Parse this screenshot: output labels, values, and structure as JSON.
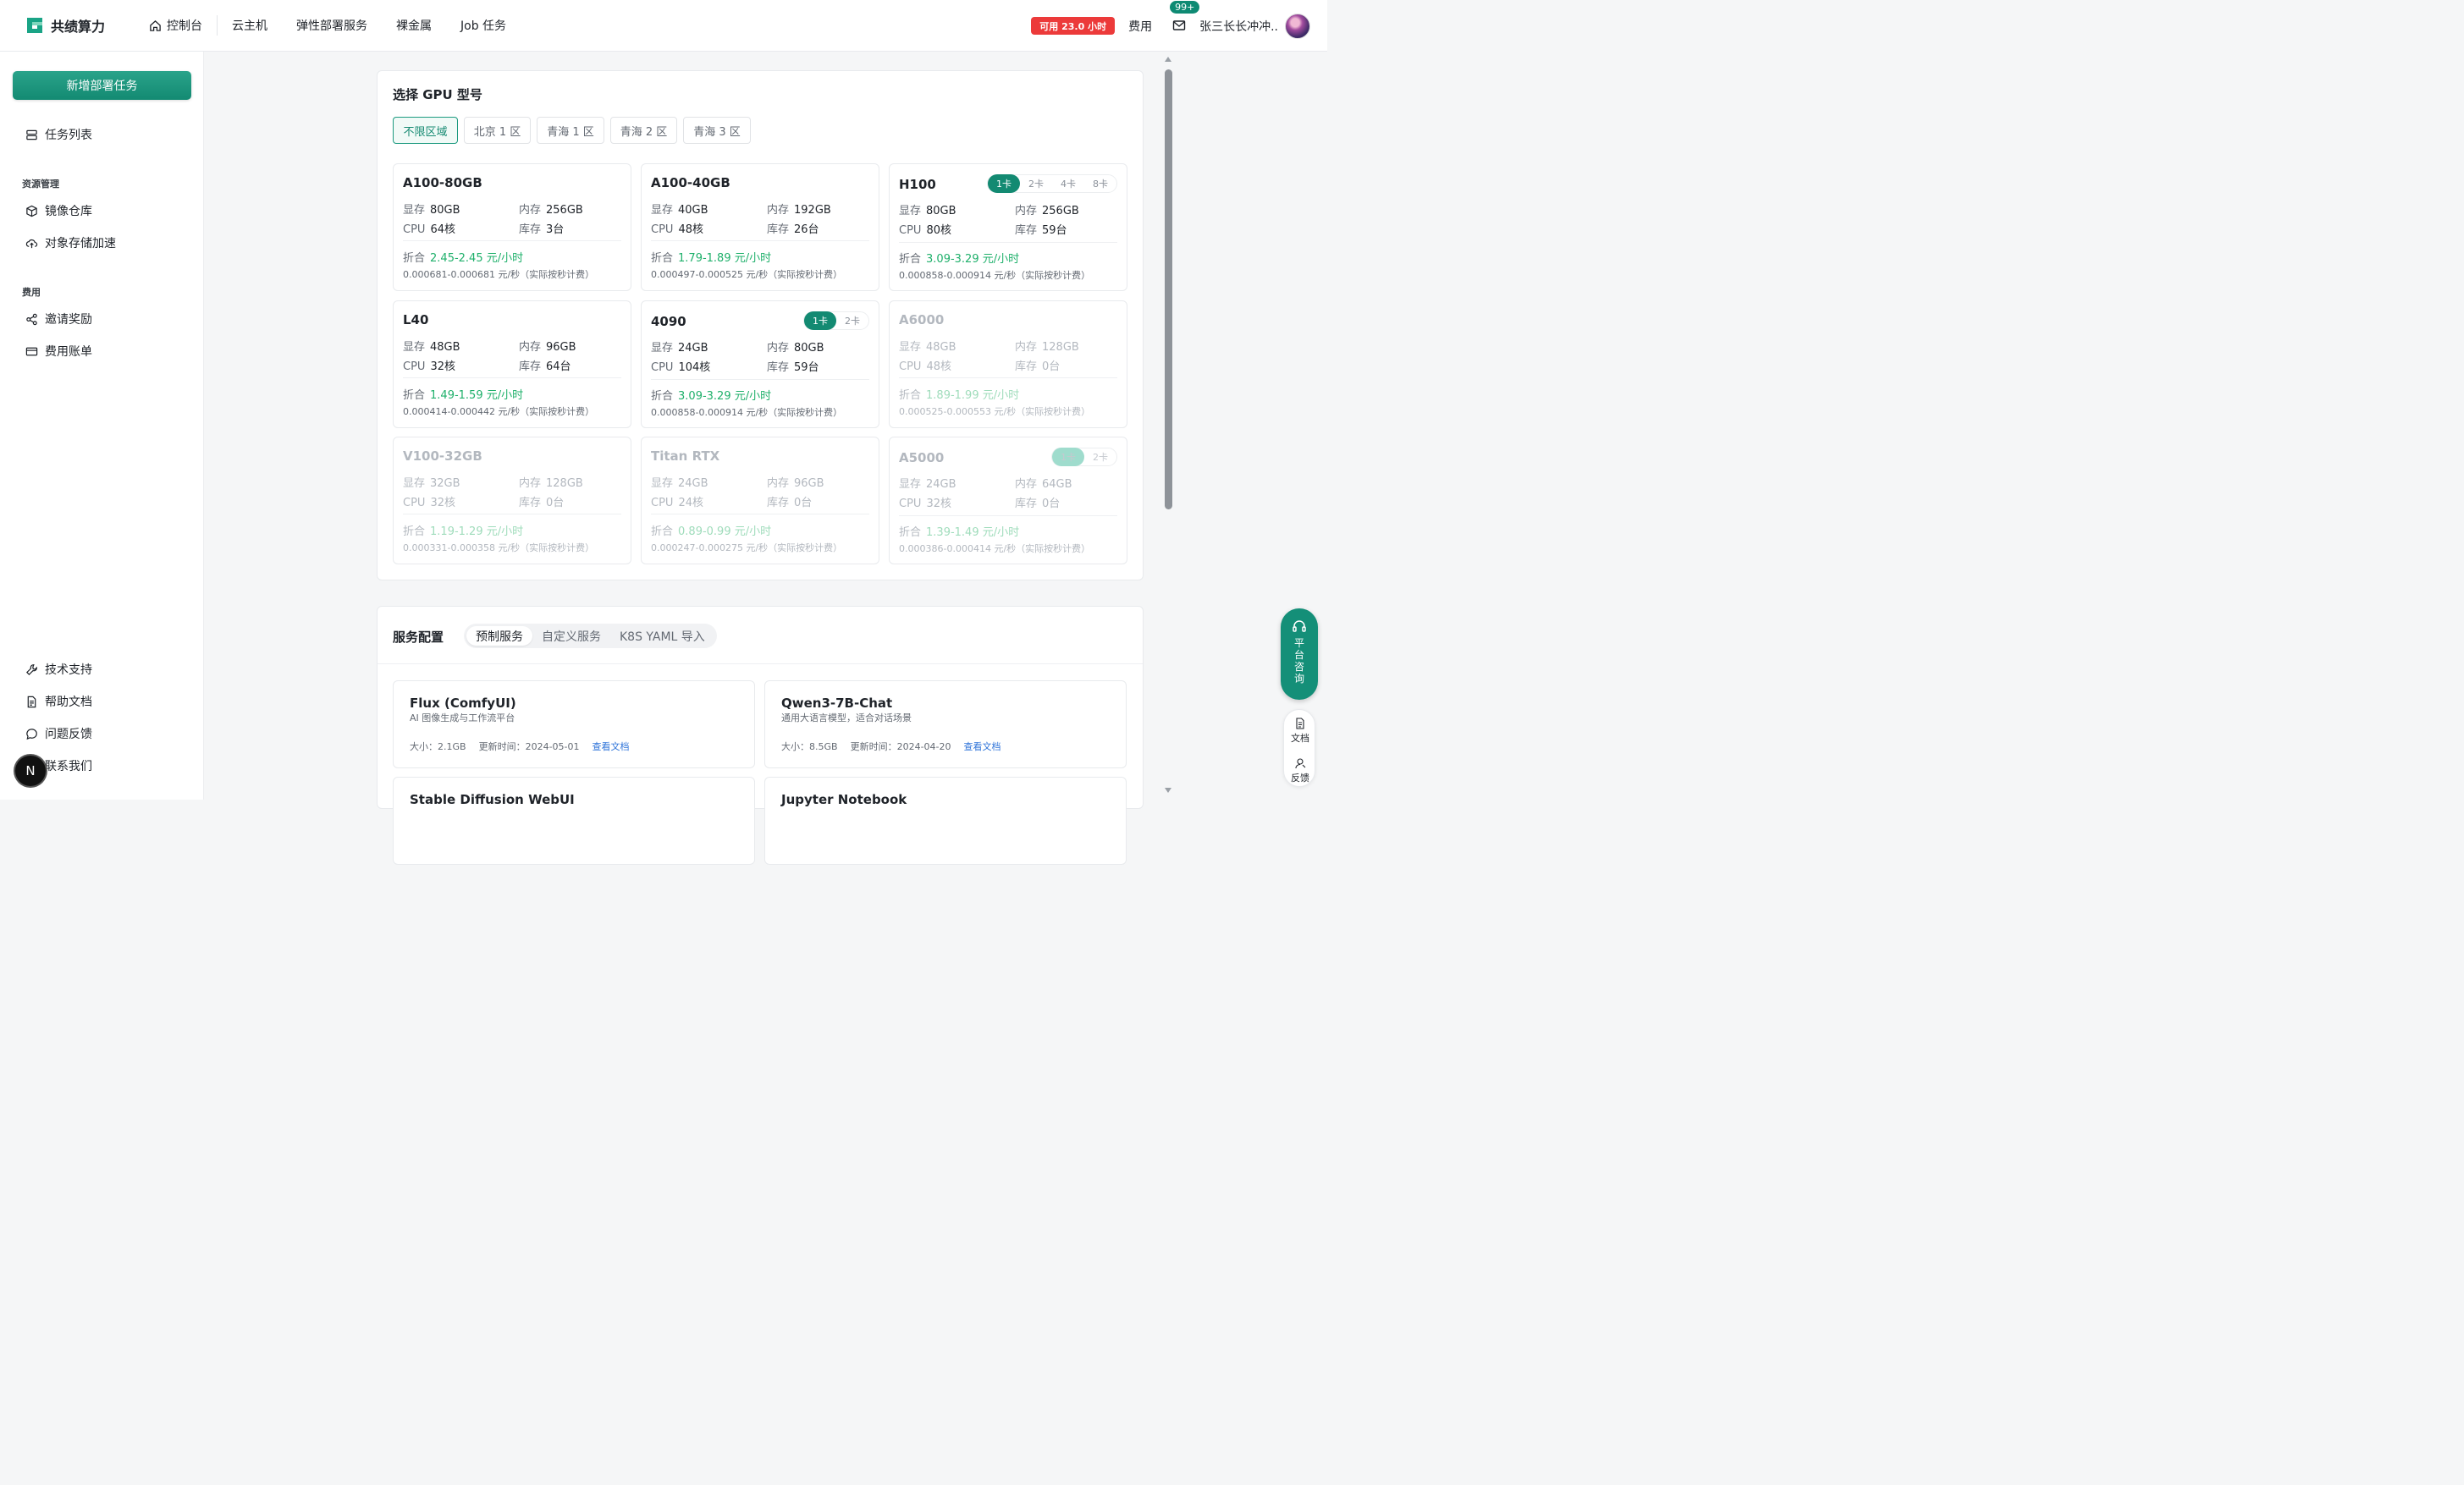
{
  "brand": {
    "name": "共绩算力"
  },
  "nav": {
    "home": "控制台",
    "items": [
      "云主机",
      "弹性部署服务",
      "裸金属",
      "Job 任务"
    ]
  },
  "topbar": {
    "availability": "可用 23.0 小时",
    "fee": "费用",
    "notifications": "99+",
    "username": "张三长长冲冲.."
  },
  "sidebar": {
    "new_task": "新增部署任务",
    "task_list": "任务列表",
    "group_resources": "资源管理",
    "image_repo": "镜像仓库",
    "object_storage": "对象存储加速",
    "group_fee": "费用",
    "invite": "邀请奖励",
    "billing": "费用账单",
    "support": "技术支持",
    "docs": "帮助文档",
    "feedback": "问题反馈",
    "contact": "联系我们",
    "n_badge": "N"
  },
  "gpu": {
    "title": "选择 GPU 型号",
    "regions": [
      "不限区域",
      "北京 1 区",
      "青海 1 区",
      "青海 2 区",
      "青海 3 区"
    ],
    "labels": {
      "vram": "显存",
      "ram": "内存",
      "cpu": "CPU",
      "stock": "库存",
      "discount": "折合"
    },
    "cards": [
      {
        "name": "A100-80GB",
        "vram": "80GB",
        "ram": "256GB",
        "cpu": "64核",
        "stock": "3台",
        "price": "2.45-2.45 元/小时",
        "per_sec": "0.000681-0.000681 元/秒（实际按秒计费）",
        "chips": []
      },
      {
        "name": "A100-40GB",
        "vram": "40GB",
        "ram": "192GB",
        "cpu": "48核",
        "stock": "26台",
        "price": "1.79-1.89 元/小时",
        "per_sec": "0.000497-0.000525 元/秒（实际按秒计费）",
        "chips": []
      },
      {
        "name": "H100",
        "vram": "80GB",
        "ram": "256GB",
        "cpu": "80核",
        "stock": "59台",
        "price": "3.09-3.29 元/小时",
        "per_sec": "0.000858-0.000914 元/秒（实际按秒计费）",
        "chips": [
          "1卡",
          "2卡",
          "4卡",
          "8卡"
        ]
      },
      {
        "name": "L40",
        "vram": "48GB",
        "ram": "96GB",
        "cpu": "32核",
        "stock": "64台",
        "price": "1.49-1.59 元/小时",
        "per_sec": "0.000414-0.000442 元/秒（实际按秒计费）",
        "chips": []
      },
      {
        "name": "4090",
        "vram": "24GB",
        "ram": "80GB",
        "cpu": "104核",
        "stock": "59台",
        "price": "3.09-3.29 元/小时",
        "per_sec": "0.000858-0.000914 元/秒（实际按秒计费）",
        "chips": [
          "1卡",
          "2卡"
        ]
      },
      {
        "name": "A6000",
        "vram": "48GB",
        "ram": "128GB",
        "cpu": "48核",
        "stock": "0台",
        "price": "1.89-1.99 元/小时",
        "per_sec": "0.000525-0.000553 元/秒（实际按秒计费）",
        "chips": []
      },
      {
        "name": "V100-32GB",
        "vram": "32GB",
        "ram": "128GB",
        "cpu": "32核",
        "stock": "0台",
        "price": "1.19-1.29 元/小时",
        "per_sec": "0.000331-0.000358 元/秒（实际按秒计费）",
        "chips": []
      },
      {
        "name": "Titan RTX",
        "vram": "24GB",
        "ram": "96GB",
        "cpu": "24核",
        "stock": "0台",
        "price": "0.89-0.99 元/小时",
        "per_sec": "0.000247-0.000275 元/秒（实际按秒计费）",
        "chips": []
      },
      {
        "name": "A5000",
        "vram": "24GB",
        "ram": "64GB",
        "cpu": "32核",
        "stock": "0台",
        "price": "1.39-1.49 元/小时",
        "per_sec": "0.000386-0.000414 元/秒（实际按秒计费）",
        "chips": [
          "1卡",
          "2卡"
        ]
      }
    ]
  },
  "services": {
    "title": "服务配置",
    "tabs": [
      "预制服务",
      "自定义服务",
      "K8S YAML 导入"
    ],
    "items": [
      {
        "name": "Flux (ComfyUI)",
        "desc": "AI 图像生成与工作流平台",
        "size": "大小：2.1GB",
        "updated": "更新时间：2024-05-01",
        "link": "查看文档"
      },
      {
        "name": "Qwen3-7B-Chat",
        "desc": "通用大语言模型，适合对话场景",
        "size": "大小：8.5GB",
        "updated": "更新时间：2024-04-20",
        "link": "查看文档"
      },
      {
        "name": "Stable Diffusion WebUI",
        "desc": "",
        "size": "",
        "updated": "",
        "link": ""
      },
      {
        "name": "Jupyter Notebook",
        "desc": "",
        "size": "",
        "updated": "",
        "link": ""
      }
    ]
  },
  "float": {
    "consult": "平台咨询",
    "docs": "文档",
    "feedback": "反馈"
  }
}
